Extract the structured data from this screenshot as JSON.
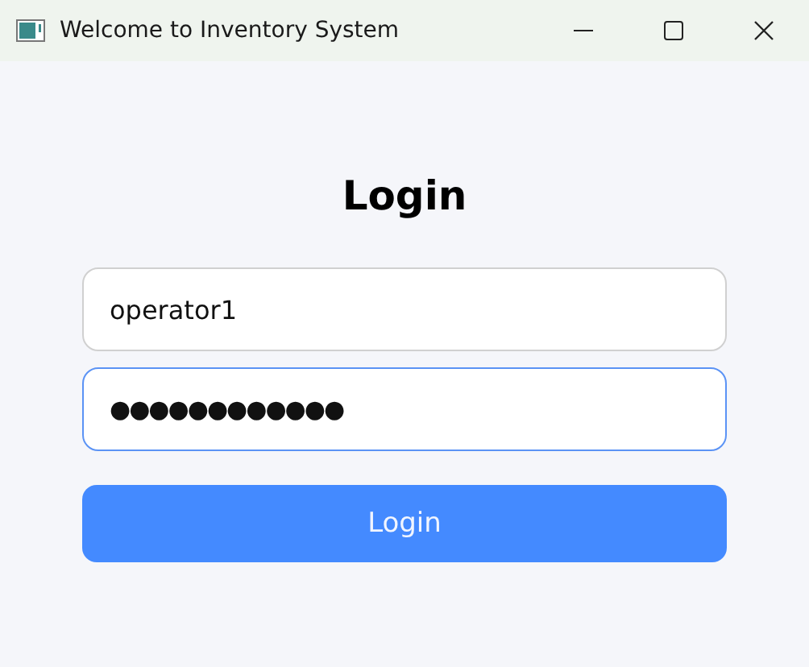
{
  "window": {
    "title": "Welcome to Inventory System"
  },
  "heading": "Login",
  "fields": [
    {
      "kind": "text",
      "value": "operator1",
      "focused": false
    },
    {
      "kind": "password",
      "value": "●●●●●●●●●●●●",
      "focused": true
    }
  ],
  "button": {
    "label": "Login"
  }
}
